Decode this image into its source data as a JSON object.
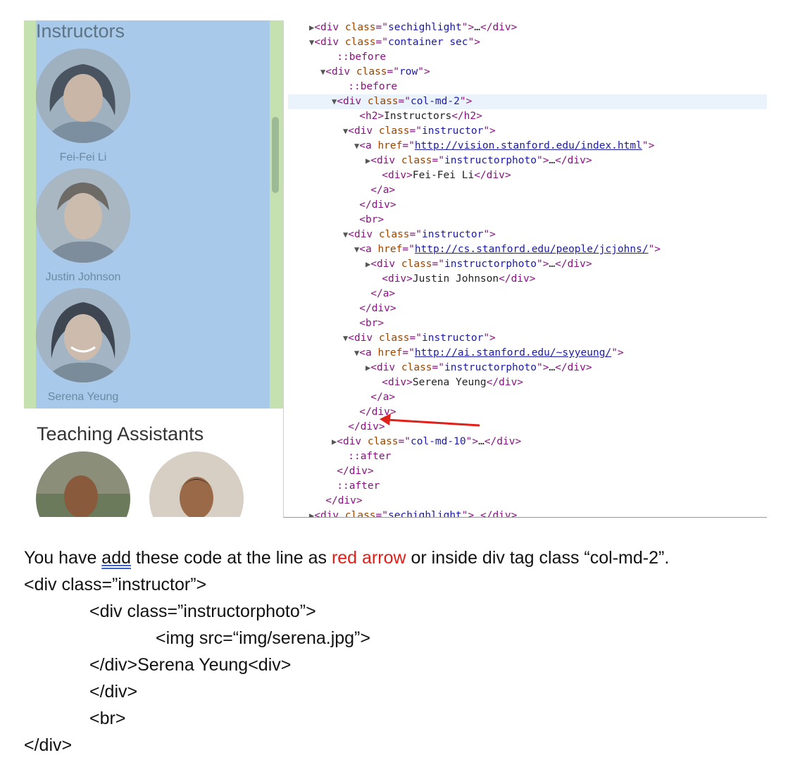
{
  "rendered_page": {
    "instructors_title": "Instructors",
    "instructors": [
      {
        "name": "Fei-Fei Li"
      },
      {
        "name": "Justin Johnson"
      },
      {
        "name": "Serena Yeung"
      }
    ],
    "ta_title": "Teaching Assistants"
  },
  "devtools": {
    "lines": [
      {
        "tri": "▶",
        "parts": [
          [
            "tag",
            "<div "
          ],
          [
            "attr",
            "class"
          ],
          [
            "tag",
            "=\""
          ],
          [
            "val",
            "sechighlight"
          ],
          [
            "tag",
            "\">"
          ],
          [
            "txt",
            "…"
          ],
          [
            "tag",
            "</div>"
          ]
        ]
      },
      {
        "tri": "▼",
        "parts": [
          [
            "tag",
            "<div "
          ],
          [
            "attr",
            "class"
          ],
          [
            "tag",
            "=\""
          ],
          [
            "val",
            "container sec"
          ],
          [
            "tag",
            "\">"
          ]
        ]
      },
      {
        "tri": "",
        "parts": [
          [
            "pseudo",
            "::before"
          ]
        ]
      },
      {
        "tri": "▼",
        "parts": [
          [
            "tag",
            "<div "
          ],
          [
            "attr",
            "class"
          ],
          [
            "tag",
            "=\""
          ],
          [
            "val",
            "row"
          ],
          [
            "tag",
            "\">"
          ]
        ]
      },
      {
        "tri": "",
        "parts": [
          [
            "pseudo",
            "::before"
          ]
        ]
      },
      {
        "tri": "▼",
        "parts": [
          [
            "tag",
            "<div "
          ],
          [
            "attr",
            "class"
          ],
          [
            "tag",
            "=\""
          ],
          [
            "val",
            "col-md-2"
          ],
          [
            "tag",
            "\">"
          ]
        ]
      },
      {
        "tri": "",
        "parts": [
          [
            "tag",
            "<h2>"
          ],
          [
            "txt",
            "Instructors"
          ],
          [
            "tag",
            "</h2>"
          ]
        ]
      },
      {
        "tri": "▼",
        "parts": [
          [
            "tag",
            "<div "
          ],
          [
            "attr",
            "class"
          ],
          [
            "tag",
            "=\""
          ],
          [
            "val",
            "instructor"
          ],
          [
            "tag",
            "\">"
          ]
        ]
      },
      {
        "tri": "▼",
        "parts": [
          [
            "tag",
            "<a "
          ],
          [
            "attr",
            "href"
          ],
          [
            "tag",
            "=\""
          ],
          [
            "link",
            "http://vision.stanford.edu/index.html"
          ],
          [
            "tag",
            "\">"
          ]
        ]
      },
      {
        "tri": "▶",
        "parts": [
          [
            "tag",
            "<div "
          ],
          [
            "attr",
            "class"
          ],
          [
            "tag",
            "=\""
          ],
          [
            "val",
            "instructorphoto"
          ],
          [
            "tag",
            "\">"
          ],
          [
            "txt",
            "…"
          ],
          [
            "tag",
            "</div>"
          ]
        ]
      },
      {
        "tri": "",
        "parts": [
          [
            "tag",
            "<div>"
          ],
          [
            "txt",
            "Fei-Fei Li"
          ],
          [
            "tag",
            "</div>"
          ]
        ]
      },
      {
        "tri": "",
        "parts": [
          [
            "tag",
            "</a>"
          ]
        ]
      },
      {
        "tri": "",
        "parts": [
          [
            "tag",
            "</div>"
          ]
        ]
      },
      {
        "tri": "",
        "parts": [
          [
            "tag",
            "<br>"
          ]
        ]
      },
      {
        "tri": "▼",
        "parts": [
          [
            "tag",
            "<div "
          ],
          [
            "attr",
            "class"
          ],
          [
            "tag",
            "=\""
          ],
          [
            "val",
            "instructor"
          ],
          [
            "tag",
            "\">"
          ]
        ]
      },
      {
        "tri": "▼",
        "parts": [
          [
            "tag",
            "<a "
          ],
          [
            "attr",
            "href"
          ],
          [
            "tag",
            "=\""
          ],
          [
            "link",
            "http://cs.stanford.edu/people/jcjohns/"
          ],
          [
            "tag",
            "\">"
          ]
        ]
      },
      {
        "tri": "▶",
        "parts": [
          [
            "tag",
            "<div "
          ],
          [
            "attr",
            "class"
          ],
          [
            "tag",
            "=\""
          ],
          [
            "val",
            "instructorphoto"
          ],
          [
            "tag",
            "\">"
          ],
          [
            "txt",
            "…"
          ],
          [
            "tag",
            "</div>"
          ]
        ]
      },
      {
        "tri": "",
        "parts": [
          [
            "tag",
            "<div>"
          ],
          [
            "txt",
            "Justin Johnson"
          ],
          [
            "tag",
            "</div>"
          ]
        ]
      },
      {
        "tri": "",
        "parts": [
          [
            "tag",
            "</a>"
          ]
        ]
      },
      {
        "tri": "",
        "parts": [
          [
            "tag",
            "</div>"
          ]
        ]
      },
      {
        "tri": "",
        "parts": [
          [
            "tag",
            "<br>"
          ]
        ]
      },
      {
        "tri": "▼",
        "parts": [
          [
            "tag",
            "<div "
          ],
          [
            "attr",
            "class"
          ],
          [
            "tag",
            "=\""
          ],
          [
            "val",
            "instructor"
          ],
          [
            "tag",
            "\">"
          ]
        ]
      },
      {
        "tri": "▼",
        "parts": [
          [
            "tag",
            "<a "
          ],
          [
            "attr",
            "href"
          ],
          [
            "tag",
            "=\""
          ],
          [
            "link",
            "http://ai.stanford.edu/~syyeung/"
          ],
          [
            "tag",
            "\">"
          ]
        ]
      },
      {
        "tri": "▶",
        "parts": [
          [
            "tag",
            "<div "
          ],
          [
            "attr",
            "class"
          ],
          [
            "tag",
            "=\""
          ],
          [
            "val",
            "instructorphoto"
          ],
          [
            "tag",
            "\">"
          ],
          [
            "txt",
            "…"
          ],
          [
            "tag",
            "</div>"
          ]
        ]
      },
      {
        "tri": "",
        "parts": [
          [
            "tag",
            "<div>"
          ],
          [
            "txt",
            "Serena Yeung"
          ],
          [
            "tag",
            "</div>"
          ]
        ]
      },
      {
        "tri": "",
        "parts": [
          [
            "tag",
            "</a>"
          ]
        ]
      },
      {
        "tri": "",
        "parts": [
          [
            "tag",
            "</div>"
          ]
        ]
      },
      {
        "tri": "",
        "parts": [
          [
            "tag",
            "</div>"
          ]
        ]
      },
      {
        "tri": "▶",
        "parts": [
          [
            "tag",
            "<div "
          ],
          [
            "attr",
            "class"
          ],
          [
            "tag",
            "=\""
          ],
          [
            "val",
            "col-md-10"
          ],
          [
            "tag",
            "\">"
          ],
          [
            "txt",
            "…"
          ],
          [
            "tag",
            "</div>"
          ]
        ]
      },
      {
        "tri": "",
        "parts": [
          [
            "pseudo",
            "::after"
          ]
        ]
      },
      {
        "tri": "",
        "parts": [
          [
            "tag",
            "</div>"
          ]
        ]
      },
      {
        "tri": "",
        "parts": [
          [
            "pseudo",
            "::after"
          ]
        ]
      },
      {
        "tri": "",
        "parts": [
          [
            "tag",
            "</div>"
          ]
        ]
      },
      {
        "tri": "▶",
        "parts": [
          [
            "tag",
            "<div "
          ],
          [
            "attr",
            "class"
          ],
          [
            "tag",
            "=\""
          ],
          [
            "val",
            "sechighlight"
          ],
          [
            "tag",
            "\">"
          ],
          [
            "txt",
            "…"
          ],
          [
            "tag",
            "</div>"
          ]
        ]
      }
    ]
  },
  "instructions": {
    "line1_a": "You have ",
    "line1_add": "add",
    "line1_b": " these code at the line as ",
    "line1_red": "red arrow",
    "line1_c": " or inside div tag class “col-md-2”.",
    "code": [
      "<div class=”instructor”>",
      "<div class=”instructorphoto”>",
      "<img src=“img/serena.jpg”>",
      "</div>Serena Yeung<div>",
      "</div>",
      "<br>",
      "</div>"
    ]
  },
  "colors": {
    "highlight_blue": "#a8c9ea",
    "highlight_green": "#c5e1b0",
    "arrow_red": "#e0201a"
  }
}
